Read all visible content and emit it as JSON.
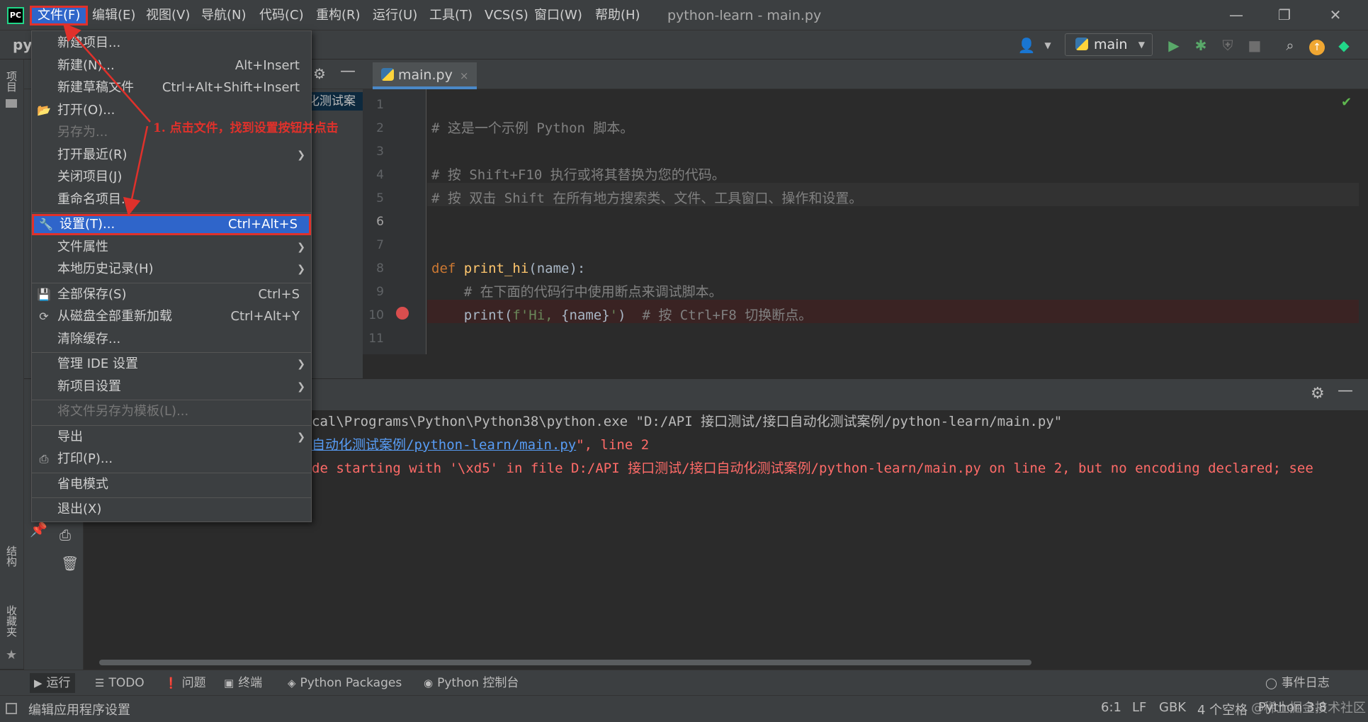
{
  "window": {
    "title": "python-learn - main.py",
    "minimize": "—",
    "maximize": "❐",
    "close": "✕"
  },
  "menubar": {
    "logo": "PC",
    "items": [
      "文件(F)",
      "编辑(E)",
      "视图(V)",
      "导航(N)",
      "代码(C)",
      "重构(R)",
      "运行(U)",
      "工具(T)",
      "VCS(S)",
      "窗口(W)",
      "帮助(H)"
    ]
  },
  "toolbar": {
    "project_label": "py",
    "run_config": "main",
    "icons": [
      "user-icon",
      "run-icon",
      "debug-icon",
      "coverage-icon",
      "stop-icon",
      "search-icon",
      "update-icon",
      "toolbox-icon"
    ]
  },
  "left_stripe": {
    "project": "项目",
    "structure": "结构",
    "favorites": "收藏夹"
  },
  "project_panel": {
    "selected_row": "化测试案"
  },
  "editor": {
    "tab": {
      "label": "main.py",
      "close": "×"
    },
    "line_numbers": [
      "1",
      "2",
      "3",
      "4",
      "5",
      "6",
      "7",
      "8",
      "9",
      "10",
      "11"
    ],
    "lines": [
      {
        "n": 2,
        "segments": [
          {
            "t": "# 这是一个示例 Python 脚本。",
            "c": "c-comment"
          }
        ]
      },
      {
        "n": 4,
        "segments": [
          {
            "t": "# 按 Shift+F10 执行或将其替换为您的代码。",
            "c": "c-comment"
          }
        ]
      },
      {
        "n": 5,
        "segments": [
          {
            "t": "# 按 双击 Shift 在所有地方搜索类、文件、工具窗口、操作和设置。",
            "c": "c-comment"
          }
        ]
      },
      {
        "n": 8,
        "segments": [
          {
            "t": "def ",
            "c": "c-kw"
          },
          {
            "t": "print_hi",
            "c": "c-fn"
          },
          {
            "t": "(name):",
            "c": "c-norm"
          }
        ]
      },
      {
        "n": 9,
        "segments": [
          {
            "t": "    # 在下面的代码行中使用断点来调试脚本。",
            "c": "c-comment"
          }
        ]
      },
      {
        "n": 10,
        "segments": [
          {
            "t": "    print(",
            "c": "c-norm"
          },
          {
            "t": "f'Hi, ",
            "c": "c-str"
          },
          {
            "t": "{name}",
            "c": "c-norm"
          },
          {
            "t": "'",
            "c": "c-str"
          },
          {
            "t": ")  ",
            "c": "c-norm"
          },
          {
            "t": "# 按 Ctrl+F8 切换断点。",
            "c": "c-comment"
          }
        ]
      }
    ]
  },
  "run_output": {
    "line1": "cal\\Programs\\Python\\Python38\\python.exe \"D:/API 接口测试/接口自动化测试案例/python-learn/main.py\"",
    "line2_link": "自动化测试案例/python-learn/main.py",
    "line2_rest": "\", line 2",
    "line3": "de starting with '\\xd5' in file D:/API 接口测试/接口自动化测试案例/python-learn/main.py on line 2, but no encoding declared; see"
  },
  "file_menu": {
    "items": [
      {
        "label": "新建项目...",
        "shortcut": "",
        "icon": "",
        "submenu": false,
        "disabled": false
      },
      {
        "label": "新建(N)...",
        "shortcut": "Alt+Insert",
        "icon": "",
        "submenu": false,
        "disabled": false
      },
      {
        "label": "新建草稿文件",
        "shortcut": "Ctrl+Alt+Shift+Insert",
        "icon": "",
        "submenu": false,
        "disabled": false
      },
      {
        "label": "打开(O)...",
        "shortcut": "",
        "icon": "folder-icon",
        "submenu": false,
        "disabled": false
      },
      {
        "label": "另存为...",
        "shortcut": "",
        "icon": "",
        "submenu": false,
        "disabled": true
      },
      {
        "label": "打开最近(R)",
        "shortcut": "",
        "icon": "",
        "submenu": true,
        "disabled": false
      },
      {
        "label": "关闭项目(J)",
        "shortcut": "",
        "icon": "",
        "submenu": false,
        "disabled": false
      },
      {
        "label": "重命名项目...",
        "shortcut": "",
        "icon": "",
        "submenu": false,
        "disabled": false
      },
      {
        "label": "设置(T)...",
        "shortcut": "Ctrl+Alt+S",
        "icon": "wrench-icon",
        "submenu": false,
        "disabled": false
      },
      {
        "label": "文件属性",
        "shortcut": "",
        "icon": "",
        "submenu": true,
        "disabled": false
      },
      {
        "label": "本地历史记录(H)",
        "shortcut": "",
        "icon": "",
        "submenu": true,
        "disabled": false
      },
      {
        "label": "全部保存(S)",
        "shortcut": "Ctrl+S",
        "icon": "save-icon",
        "submenu": false,
        "disabled": false
      },
      {
        "label": "从磁盘全部重新加载",
        "shortcut": "Ctrl+Alt+Y",
        "icon": "reload-icon",
        "submenu": false,
        "disabled": false
      },
      {
        "label": "清除缓存...",
        "shortcut": "",
        "icon": "",
        "submenu": false,
        "disabled": false
      },
      {
        "label": "管理 IDE 设置",
        "shortcut": "",
        "icon": "",
        "submenu": true,
        "disabled": false
      },
      {
        "label": "新项目设置",
        "shortcut": "",
        "icon": "",
        "submenu": true,
        "disabled": false
      },
      {
        "label": "将文件另存为模板(L)...",
        "shortcut": "",
        "icon": "",
        "submenu": false,
        "disabled": true
      },
      {
        "label": "导出",
        "shortcut": "",
        "icon": "",
        "submenu": true,
        "disabled": false
      },
      {
        "label": "打印(P)...",
        "shortcut": "",
        "icon": "print-icon",
        "submenu": false,
        "disabled": false
      },
      {
        "label": "省电模式",
        "shortcut": "",
        "icon": "",
        "submenu": false,
        "disabled": false
      },
      {
        "label": "退出(X)",
        "shortcut": "",
        "icon": "",
        "submenu": false,
        "disabled": false
      }
    ],
    "highlighted": "设置(T)..."
  },
  "annotation": {
    "text": "1. 点击文件，找到设置按钮并点击",
    "color": "#e0312b"
  },
  "bottom_tabs": [
    "运行",
    "TODO",
    "问题",
    "终端",
    "Python Packages",
    "Python 控制台"
  ],
  "event_log": "事件日志",
  "statusbar": {
    "left": "编辑应用程序设置",
    "position": "6:1",
    "line_sep": "LF",
    "encoding": "GBK",
    "indent": "4 个空格",
    "interpreter": "Python 3.8"
  },
  "watermark": "@稀土掘金技术社区",
  "colors": {
    "accent": "#2f65ca",
    "annotation_red": "#e0312b",
    "bg_dark": "#2b2b2b",
    "panel": "#3c3f41"
  }
}
